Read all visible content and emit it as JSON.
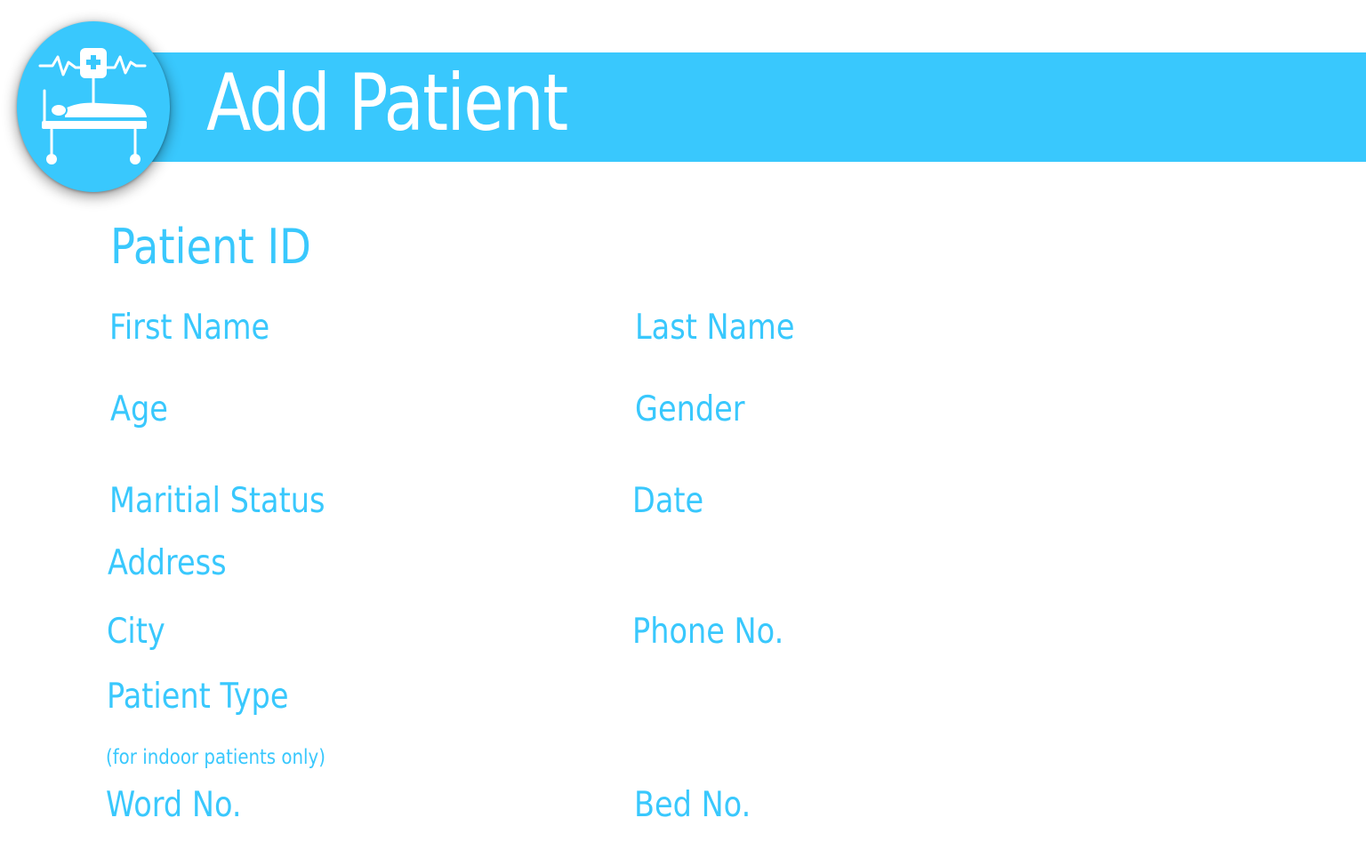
{
  "header": {
    "title": "Add Patient",
    "logo_icon": "hospital-bed-iv-icon",
    "accent_color": "#39c8fd"
  },
  "form": {
    "patient_id_label": "Patient ID",
    "first_name_label": "First Name",
    "last_name_label": "Last Name",
    "age_label": "Age",
    "gender_label": "Gender",
    "marital_status_label": "Maritial Status",
    "date_label": "Date",
    "address_label": "Address",
    "city_label": "City",
    "phone_label": "Phone No.",
    "patient_type_label": "Patient Type",
    "indoor_note": "(for indoor patients only)",
    "ward_no_label": "Word No.",
    "bed_no_label": "Bed No."
  }
}
